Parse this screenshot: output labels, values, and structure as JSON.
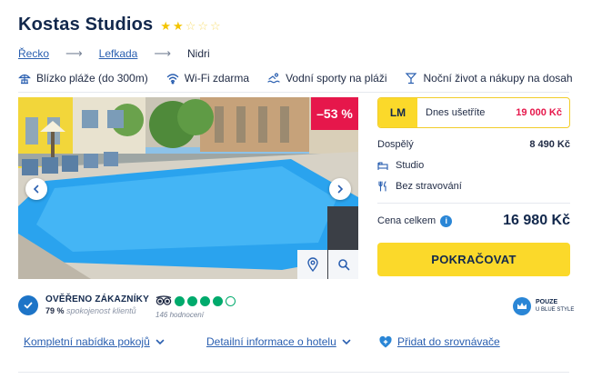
{
  "hotel": {
    "name": "Kostas Studios",
    "stars_filled": 2,
    "stars_total": 5
  },
  "breadcrumb": {
    "items": [
      "Řecko",
      "Lefkada",
      "Nidri"
    ],
    "separator": "⟶"
  },
  "amenities": [
    {
      "icon": "beach-umbrella-icon",
      "label": "Blízko pláže (do 300m)"
    },
    {
      "icon": "wifi-icon",
      "label": "Wi-Fi zdarma"
    },
    {
      "icon": "swimmer-icon",
      "label": "Vodní sporty na pláži"
    },
    {
      "icon": "cocktail-icon",
      "label": "Noční život a nákupy na dosah"
    }
  ],
  "photo": {
    "discount": "–53 %",
    "prev_icon": "chevron-left-icon",
    "next_icon": "chevron-right-icon",
    "map_icon": "map-pin-icon",
    "zoom_icon": "search-icon"
  },
  "pricing": {
    "lm_badge": "LM",
    "save_label": "Dnes ušetříte",
    "save_amount": "19 000 Kč",
    "adult_label": "Dospělý",
    "adult_price": "8 490 Kč",
    "room_type": "Studio",
    "board": "Bez stravování",
    "total_label": "Cena celkem",
    "total_price": "16 980 Kč",
    "cta_label": "POKRAČOVAT"
  },
  "verification": {
    "title": "OVĚŘENO ZÁKAZNÍKY",
    "percent": "79 %",
    "satisfied_label": "spokojenost klientů"
  },
  "tripadvisor": {
    "rating_filled": 4,
    "rating_total": 5,
    "review_count": "146 hodnocení"
  },
  "blue_style": {
    "line1": "POUZE",
    "line2": "U BLUE STYLE"
  },
  "links": {
    "rooms": "Kompletní nabídka pokojů",
    "details": "Detailní informace o hotelu",
    "compare": "Přidat do srovnávače"
  },
  "colors": {
    "brand_navy": "#12284c",
    "accent_yellow": "#fbd92a",
    "discount_red": "#e6174b",
    "link_blue": "#2a5fb0",
    "tripadvisor_green": "#00aa6c"
  }
}
